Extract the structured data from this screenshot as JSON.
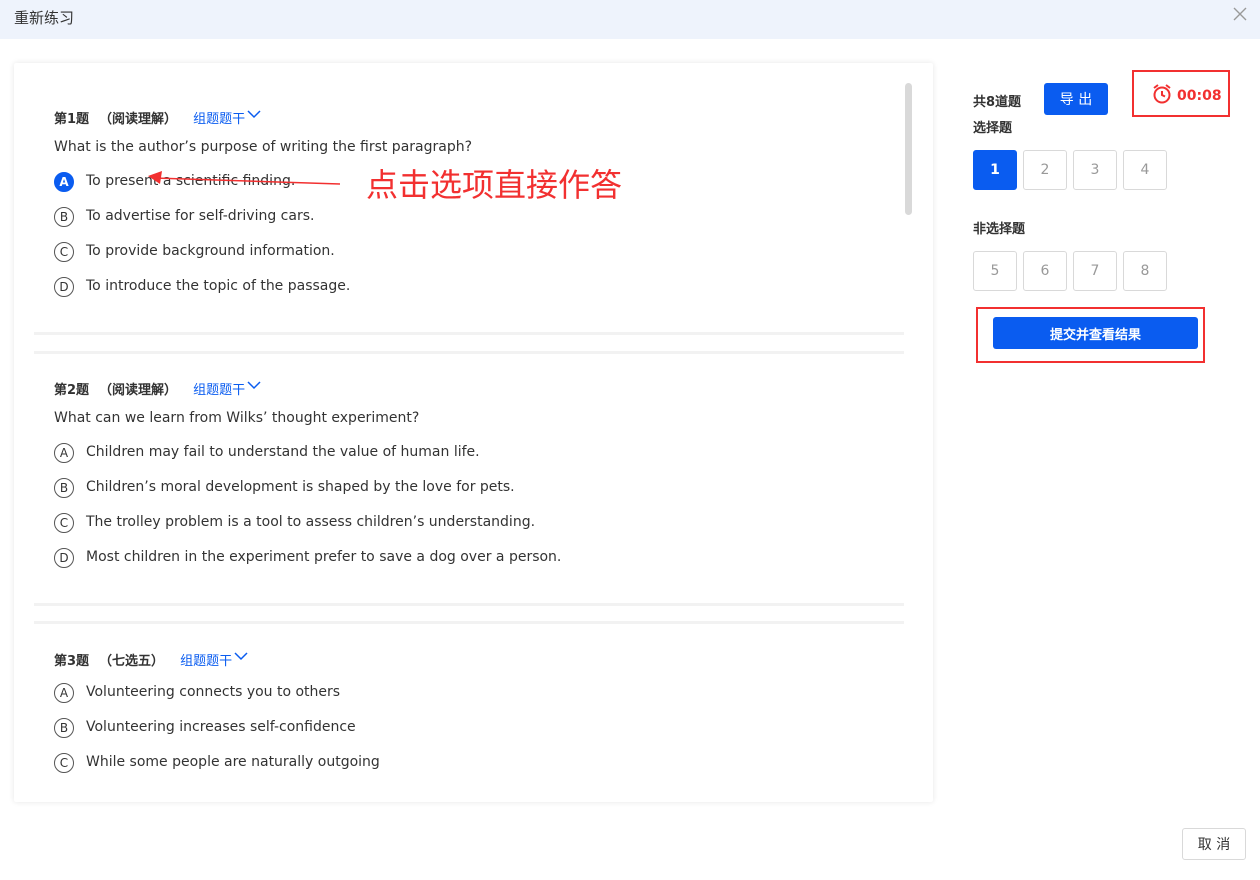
{
  "window": {
    "title": "重新练习",
    "close_icon": "close-icon"
  },
  "questions": [
    {
      "number_label": "第1题",
      "type_label": "（阅读理解）",
      "group_label": "组题题干",
      "stem": "What is the author’s purpose of writing the first paragraph?",
      "options": [
        {
          "letter": "A",
          "text": "To present a scientific finding.",
          "selected": true
        },
        {
          "letter": "B",
          "text": "To advertise for self-driving cars.",
          "selected": false
        },
        {
          "letter": "C",
          "text": "To provide background information.",
          "selected": false
        },
        {
          "letter": "D",
          "text": "To introduce the topic of the passage.",
          "selected": false
        }
      ]
    },
    {
      "number_label": "第2题",
      "type_label": "（阅读理解）",
      "group_label": "组题题干",
      "stem": "What can we learn from Wilks’ thought experiment?",
      "options": [
        {
          "letter": "A",
          "text": "Children may fail to understand the value of human life.",
          "selected": false
        },
        {
          "letter": "B",
          "text": "Children’s moral development is shaped by the love for pets.",
          "selected": false
        },
        {
          "letter": "C",
          "text": "The trolley problem is a tool to assess children’s understanding.",
          "selected": false
        },
        {
          "letter": "D",
          "text": "Most children in the experiment prefer to save a dog over a person.",
          "selected": false
        }
      ]
    },
    {
      "number_label": "第3题",
      "type_label": "（七选五）",
      "group_label": "组题题干",
      "stem": "",
      "options": [
        {
          "letter": "A",
          "text": "Volunteering connects you to others",
          "selected": false
        },
        {
          "letter": "B",
          "text": "Volunteering increases self-confidence",
          "selected": false
        },
        {
          "letter": "C",
          "text": "While some people are naturally outgoing",
          "selected": false
        }
      ]
    }
  ],
  "annotation": {
    "text": "点击选项直接作答",
    "color": "#f23030"
  },
  "sidebar": {
    "count_label": "共8道题",
    "export_label": "导 出",
    "timer": "00:08",
    "timer_icon": "alarm-clock-icon",
    "choice_label": "选择题",
    "choice_numbers": [
      "1",
      "2",
      "3",
      "4"
    ],
    "active_number": "1",
    "nonchoice_label": "非选择题",
    "nonchoice_numbers": [
      "5",
      "6",
      "7",
      "8"
    ],
    "submit_label": "提交并查看结果"
  },
  "footer": {
    "cancel_label": "取 消"
  },
  "colors": {
    "accent": "#0a5cf0",
    "highlight": "#f23030",
    "title_bar": "#eef3fc"
  }
}
